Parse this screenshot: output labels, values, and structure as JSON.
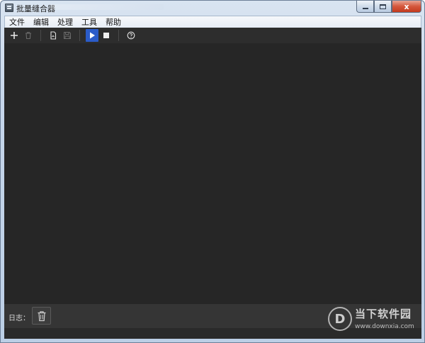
{
  "window": {
    "title": "批量缝合器",
    "caption_buttons": {
      "close": "x"
    }
  },
  "menubar": {
    "items": [
      "文件",
      "编辑",
      "处理",
      "工具",
      "帮助"
    ]
  },
  "toolbar": {
    "buttons": [
      {
        "icon": "plus-icon",
        "enabled": true
      },
      {
        "icon": "trash-icon",
        "enabled": false
      },
      {
        "icon": "open-file-icon",
        "enabled": true
      },
      {
        "icon": "save-icon",
        "enabled": false
      },
      {
        "icon": "play-icon",
        "enabled": true,
        "active": true
      },
      {
        "icon": "stop-icon",
        "enabled": true
      },
      {
        "icon": "help-icon",
        "enabled": true
      }
    ]
  },
  "log": {
    "label": "日志："
  },
  "watermark": {
    "logo_glyph": "D",
    "name": "当下软件园",
    "url": "www.downxia.com"
  },
  "colors": {
    "content_bg": "#262626",
    "toolbar_bg": "#2d2d2d",
    "log_bg": "#353535",
    "accent": "#2b5cc9"
  }
}
